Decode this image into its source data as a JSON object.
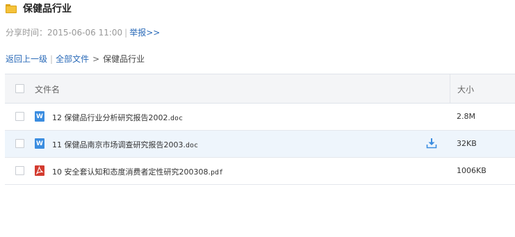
{
  "title": "保健品行业",
  "meta": {
    "share_label": "分享时间：",
    "share_time": "2015-06-06 11:00",
    "separator": "|",
    "report": "举报>>"
  },
  "breadcrumb": {
    "back": "返回上一级",
    "separator": "|",
    "all_files": "全部文件",
    "arrow": ">",
    "current": "保健品行业"
  },
  "table": {
    "headers": {
      "name": "文件名",
      "size": "大小"
    },
    "rows": [
      {
        "icon": "word-doc-icon",
        "type_letter": "W",
        "name": "12 保健品行业分析研究报告2002.",
        "ext": "doc",
        "size": "2.8M"
      },
      {
        "icon": "word-doc-icon",
        "type_letter": "W",
        "name": "11 保健品南京市场调查研究报告2003.",
        "ext": "doc",
        "size": "32KB"
      },
      {
        "icon": "pdf-icon",
        "type_letter": "",
        "name": "10 安全套认知和态度消费者定性研究200308.",
        "ext": "pdf",
        "size": "1006KB"
      }
    ]
  },
  "colors": {
    "link": "#2a6ab8",
    "hover_row": "#eef5fc",
    "word": "#3b8de0",
    "pdf": "#d33b2f",
    "download": "#3b8de0"
  }
}
